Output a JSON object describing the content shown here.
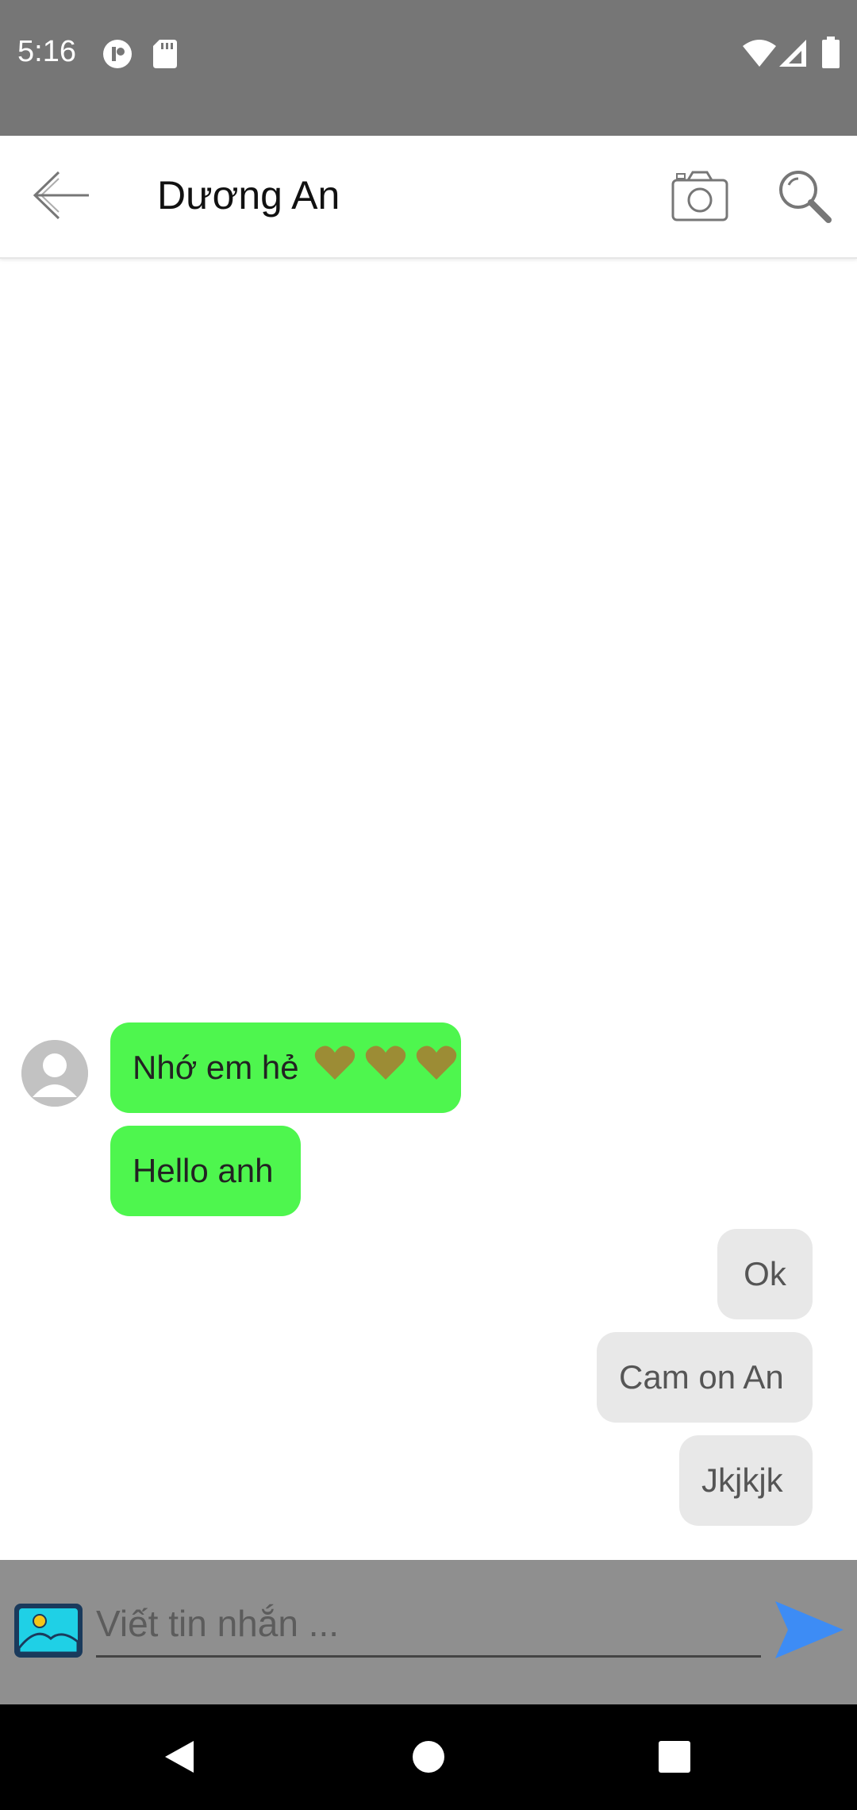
{
  "status_bar": {
    "time": "5:16",
    "icons": [
      "app-notification-icon",
      "sd-card-icon",
      "wifi-icon",
      "signal-icon",
      "battery-icon"
    ]
  },
  "toolbar": {
    "back_icon": "arrow-left-icon",
    "contact_name": "Dương An",
    "camera_icon": "camera-icon",
    "search_icon": "search-icon"
  },
  "messages": [
    {
      "direction": "incoming",
      "text": "Nhớ em hẻ",
      "emoji": "💛💛💛"
    },
    {
      "direction": "incoming",
      "text": "Hello anh"
    },
    {
      "direction": "outgoing",
      "text": "Ok"
    },
    {
      "direction": "outgoing",
      "text": "Cam on An"
    },
    {
      "direction": "outgoing",
      "text": "Jkjkjk"
    }
  ],
  "input_bar": {
    "gallery_icon": "image-gallery-icon",
    "placeholder": "Viết tin nhắn ...",
    "value": "",
    "send_icon": "send-icon"
  },
  "nav_bar": {
    "icons": [
      "back-triangle-icon",
      "home-circle-icon",
      "recents-square-icon"
    ]
  },
  "colors": {
    "status_bar": "#767676",
    "incoming_bubble": "#4ef64e",
    "outgoing_bubble": "#e8e8e8",
    "input_bar": "#8f8f8f",
    "send_accent": "#3d8cf5",
    "heart": "#9c8c35"
  }
}
